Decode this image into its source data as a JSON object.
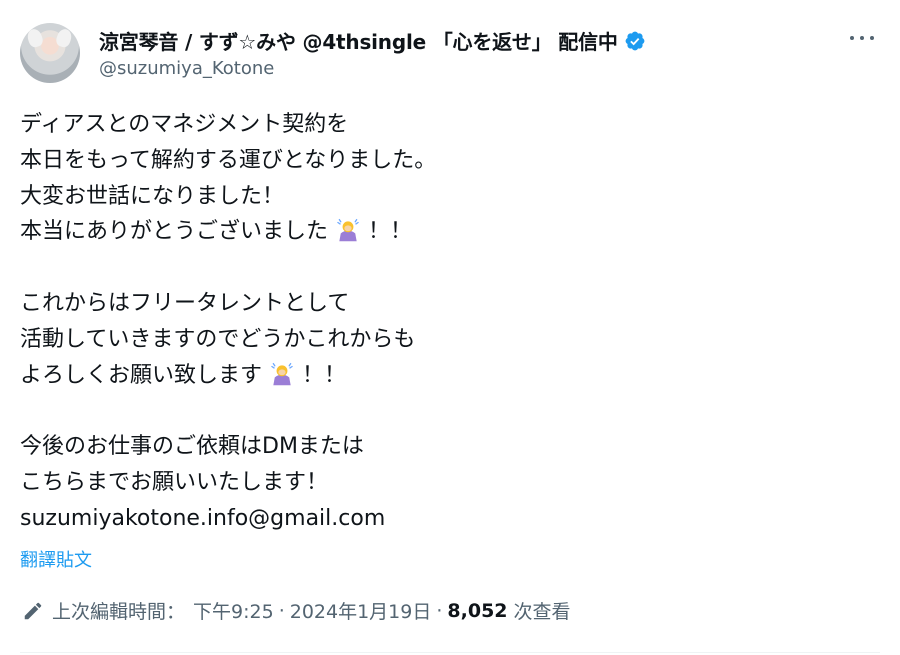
{
  "author": {
    "display_name": "涼宮琴音 / すず☆みや @4thsingle 「心を返せ」 配信中",
    "handle": "@suzumiya_Kotone",
    "verified_color": "#1d9bf0"
  },
  "post": {
    "lines": [
      "ディアスとのマネジメント契約を",
      "本日をもって解約する運びとなりました。",
      "大変お世話になりました！",
      "本当にありがとうございました",
      "！！",
      "これからはフリータレントとして",
      "活動していきますのでどうかこれからも",
      "よろしくお願い致します",
      "！！",
      "今後のお仕事のご依頼はDMまたは",
      "こちらまでお願いいたします！",
      "suzumiyakotone.info@gmail.com"
    ]
  },
  "actions": {
    "translate_label": "翻譯貼文"
  },
  "meta": {
    "edited_label": "上次編輯時間：",
    "time": "下午9:25",
    "date": "2024年1月19日",
    "views": "8,052",
    "views_label": "次查看"
  },
  "icons": {
    "verified": "verified-badge-icon",
    "more": "more-options-icon",
    "edit": "pencil-icon",
    "emoji": "person-bowing-emoji"
  }
}
